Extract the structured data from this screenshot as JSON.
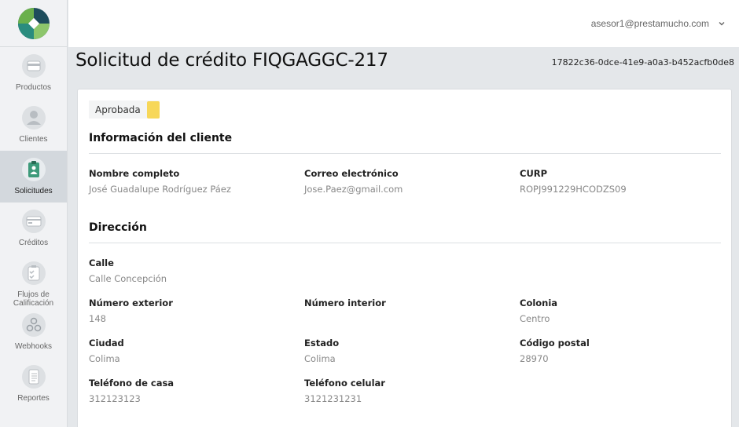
{
  "sidebar": {
    "items": [
      {
        "label": "Productos",
        "icon": "products-icon"
      },
      {
        "label": "Clientes",
        "icon": "clients-icon"
      },
      {
        "label": "Solicitudes",
        "icon": "requests-icon"
      },
      {
        "label": "Créditos",
        "icon": "credit-card-icon"
      },
      {
        "label": "Flujos de Calificación",
        "icon": "checklist-icon"
      },
      {
        "label": "Webhooks",
        "icon": "webhook-icon"
      },
      {
        "label": "Reportes",
        "icon": "reports-icon"
      }
    ],
    "active": "Solicitudes"
  },
  "topbar": {
    "user_email": "asesor1@prestamucho.com"
  },
  "page": {
    "title": "Solicitud de crédito FIQGAGGC-217",
    "request_id": "17822c36-0dce-41e9-a0a3-b452acfb0de8"
  },
  "status": {
    "label": "Aprobada",
    "color": "#f7d759"
  },
  "client_section": {
    "title": "Información del cliente",
    "full_name_label": "Nombre completo",
    "full_name": "José Guadalupe Rodríguez Páez",
    "email_label": "Correo electrónico",
    "email": "Jose.Paez@gmail.com",
    "curp_label": "CURP",
    "curp": "ROPJ991229HCODZS09"
  },
  "address_section": {
    "title": "Dirección",
    "street_label": "Calle",
    "street": "Calle Concepción",
    "ext_number_label": "Número exterior",
    "ext_number": "148",
    "int_number_label": "Número interior",
    "int_number": "",
    "colony_label": "Colonia",
    "colony": "Centro",
    "city_label": "Ciudad",
    "city": "Colima",
    "state_label": "Estado",
    "state": "Colima",
    "zip_label": "Código postal",
    "zip": "28970",
    "home_phone_label": "Teléfono de casa",
    "home_phone": "312123123",
    "cell_phone_label": "Teléfono celular",
    "cell_phone": "3121231231"
  },
  "colors": {
    "accent": "#3d9a7a",
    "status": "#f7d759",
    "logo_dark": "#1e4d5c",
    "logo_green": "#6ab04c",
    "logo_teal": "#2a8c7e"
  }
}
